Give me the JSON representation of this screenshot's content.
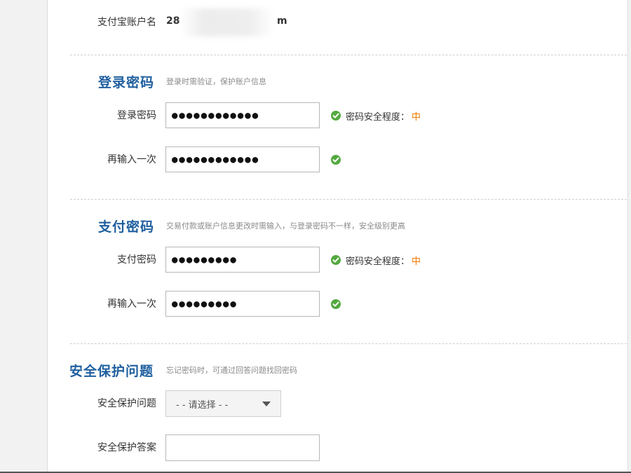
{
  "account": {
    "label": "支付宝账户名",
    "value_prefix": "28",
    "value_suffix": "m"
  },
  "login_section": {
    "title": "登录密码",
    "description": "登录时需验证，保护账户信息",
    "password_label": "登录密码",
    "password_value": "●●●●●●●●●●●●",
    "confirm_label": "再输入一次",
    "confirm_value": "●●●●●●●●●●●●",
    "strength_label": "密码安全程度：",
    "strength_level": "中"
  },
  "pay_section": {
    "title": "支付密码",
    "description": "交易付款或账户信息更改时需输入，与登录密码不一样，安全级别更高",
    "password_label": "支付密码",
    "password_value": "●●●●●●●●●",
    "confirm_label": "再输入一次",
    "confirm_value": "●●●●●●●●●",
    "strength_label": "密码安全程度：",
    "strength_level": "中"
  },
  "security_section": {
    "title": "安全保护问题",
    "description": "忘记密码时，可通过回答问题找回密码",
    "question_label": "安全保护问题",
    "question_selected": "- - 请选择 - -",
    "answer_label": "安全保护答案",
    "answer_value": ""
  },
  "colors": {
    "section_title": "#1f5f9f",
    "ok_icon": "#53a93f",
    "strength_level": "#f07a00"
  },
  "icons": {
    "ok": "check-circle-icon",
    "dropdown": "chevron-down-icon"
  }
}
